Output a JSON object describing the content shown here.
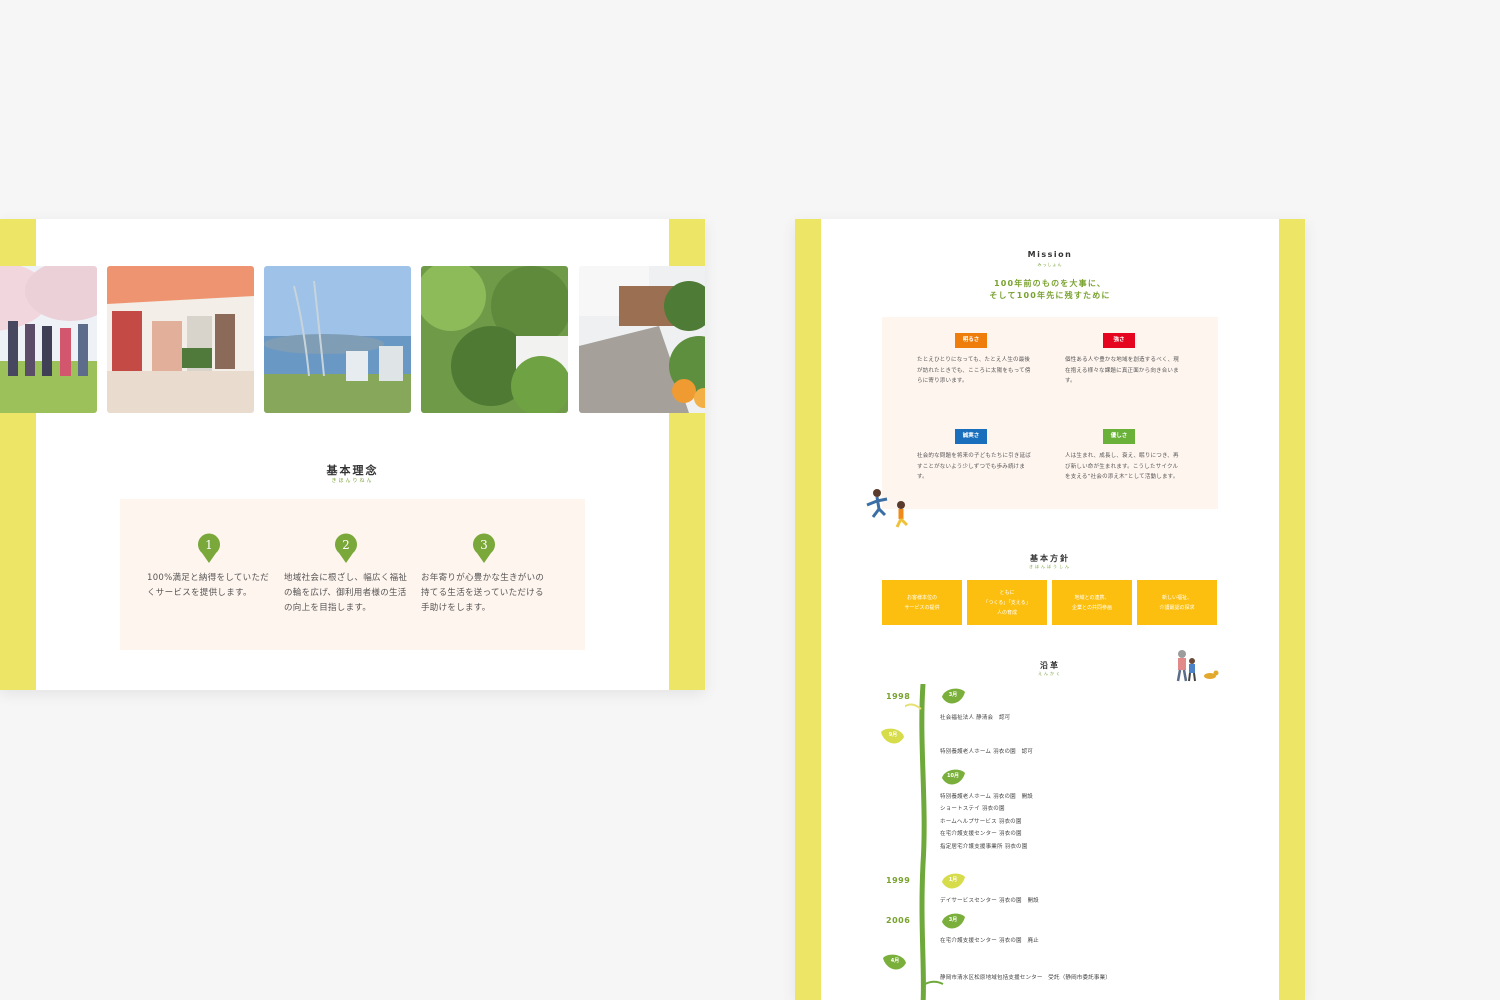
{
  "left_card": {
    "photos": [
      {
        "name": "cherry-blossom-walk-photo"
      },
      {
        "name": "tent-cooking-photo"
      },
      {
        "name": "sea-view-photo"
      },
      {
        "name": "green-garden-photo"
      },
      {
        "name": "terrace-flowers-photo"
      }
    ],
    "kihon_rinen": {
      "title": "基本理念",
      "reading": "きほんりねん",
      "items": [
        {
          "number": "1",
          "text": "100%満足と納得をしていただくサービスを提供します。"
        },
        {
          "number": "2",
          "text": "地域社会に根ざし、幅広く福祉の輪を広げ、御利用者様の生活の向上を目指します。"
        },
        {
          "number": "3",
          "text": "お年寄りが心豊かな生きがいの持てる生活を送っていただける手助けをします。"
        }
      ]
    }
  },
  "right_card": {
    "mission": {
      "title": "Mission",
      "reading": "みっしょん",
      "lead_line1": "100年前のものを大事に、",
      "lead_line2": "そして100年先に残すために",
      "values": [
        {
          "label": "明るさ",
          "color": "#ee7d0c",
          "text": "たとえひとりになっても、たとえ人生の最後が訪れたときでも、こころに太陽をもって傍らに寄り添います。"
        },
        {
          "label": "強さ",
          "color": "#e5051f",
          "text": "個性ある人や豊かな地域を創造するべく、現在抱える様々な課題に真正面から向き合います。"
        },
        {
          "label": "誠実さ",
          "color": "#1a6fbd",
          "text": "社会的な問題を将来の子どもたちに引き延ばすことがないよう少しずつでも歩み続けます。"
        },
        {
          "label": "優しさ",
          "color": "#6ab13a",
          "text": "人は生まれ、成長し、衰え、眠りにつき、再び新しい命が生まれます。こうしたサイクルを支える”社会の添え木”として活動します。"
        }
      ]
    },
    "kihon_houshin": {
      "title": "基本方針",
      "reading": "きほんほうしん",
      "items": [
        "お客様本位の\nサービスの提供",
        "ともに\n「つくる」「支える」\n人の育成",
        "地域との連携、\n企業との共同参画",
        "新しい福祉、\n介護最認の探求"
      ]
    },
    "enkaku": {
      "title": "沿革",
      "reading": "えんかく",
      "years": [
        "1998",
        "1999",
        "2006"
      ],
      "months": [
        "3月",
        "9月",
        "10月",
        "1月",
        "3月",
        "4月"
      ],
      "entries": [
        "社会福祉法人 静清会　認可",
        "特別養護老人ホーム 羽衣の園　認可",
        "特別養護老人ホーム 羽衣の園　開設\nショートステイ 羽衣の園\nホームヘルプサービス 羽衣の園\n在宅介護支援センター 羽衣の園\n指定居宅介護支援事業所 羽衣の園",
        "デイサービスセンター 羽衣の園　開設",
        "在宅介護支援センター 羽衣の園　廃止",
        "静岡市清水区松原地域包括支援センター　受託（静岡市委託事業）"
      ]
    }
  }
}
